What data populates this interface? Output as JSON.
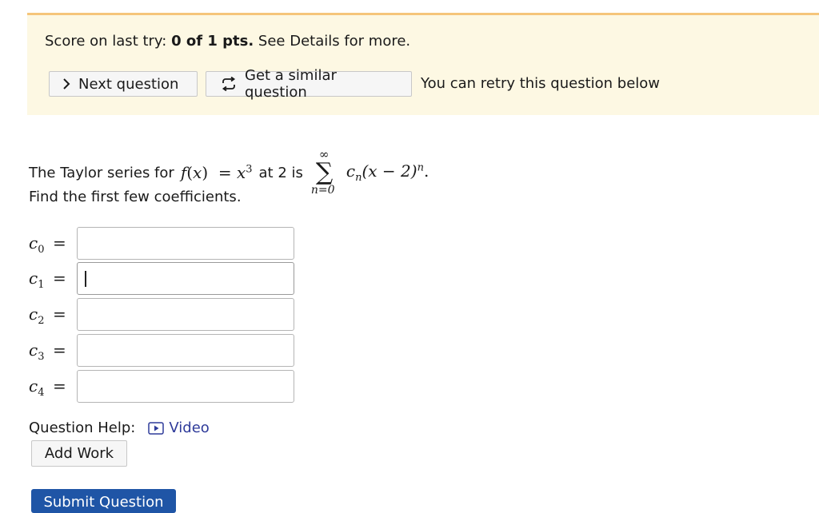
{
  "banner": {
    "score_prefix": "Score on last try:",
    "score_value": "0 of 1 pts.",
    "score_suffix": "See Details for more.",
    "next_button_label": "Next question",
    "similar_button_label": "Get a similar question",
    "retry_text": "You can retry this question below"
  },
  "question": {
    "intro_text": "The Taylor series for",
    "func_lhs": "f",
    "func_arg": "x",
    "func_rhs_base": "x",
    "func_rhs_exp": "3",
    "at_text": "at 2 is",
    "sum_upper": "∞",
    "sum_lower": "n=0",
    "series_coef": "c",
    "series_coef_sub": "n",
    "series_base": "(x − 2)",
    "series_exp": "n",
    "series_end": ".",
    "find_text": "Find the first few coefficients."
  },
  "coefficients": [
    {
      "name": "c",
      "sub": "0",
      "eq": "=",
      "value": ""
    },
    {
      "name": "c",
      "sub": "1",
      "eq": "=",
      "value": ""
    },
    {
      "name": "c",
      "sub": "2",
      "eq": "=",
      "value": ""
    },
    {
      "name": "c",
      "sub": "3",
      "eq": "=",
      "value": ""
    },
    {
      "name": "c",
      "sub": "4",
      "eq": "=",
      "value": ""
    }
  ],
  "help": {
    "label": "Question Help:",
    "video_label": "Video",
    "add_work_label": "Add Work",
    "submit_label": "Submit Question"
  },
  "colors": {
    "banner_bg": "#fdf8e3",
    "banner_border": "#f5c57a",
    "link": "#2f3b9a",
    "submit_bg": "#1f55a6"
  }
}
